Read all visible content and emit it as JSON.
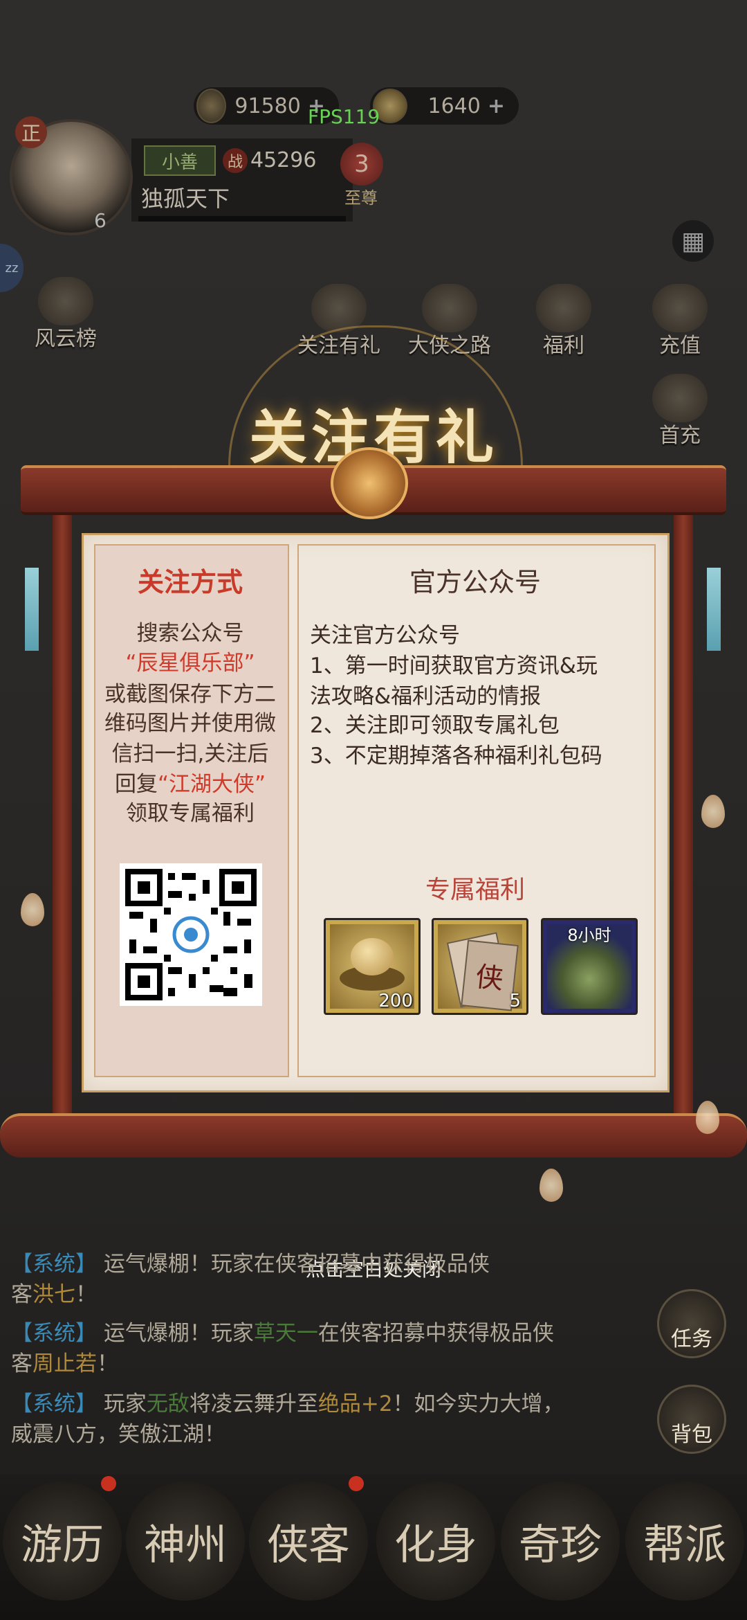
{
  "hud": {
    "coins": "91580",
    "ingots": "1640",
    "plus": "+",
    "fps": "FPS119",
    "rank_badge": "正",
    "level": "6",
    "title_tag": "小善",
    "power_icon": "战",
    "power": "45296",
    "player_name": "独孤天下",
    "vip_level": "3",
    "vip_label": "至尊",
    "grid_icon": "grid-icon",
    "zz_label": "zz"
  },
  "menu": [
    {
      "label": "风云榜"
    },
    {
      "label": "关注有礼"
    },
    {
      "label": "大侠之路"
    },
    {
      "label": "福利"
    },
    {
      "label": "充值"
    },
    {
      "label": "首充"
    }
  ],
  "dialog": {
    "banner": "关注有礼",
    "left": {
      "title": "关注方式",
      "line1": "搜索公众号",
      "line2": "“辰星俱乐部”",
      "line3": "或截图保存下方二",
      "line4": "维码图片并使用微",
      "line5": "信扫一扫,关注后",
      "line6_prefix": "回复",
      "line6_highlight": "“江湖大侠”",
      "line7": "领取专属福利"
    },
    "right": {
      "title": "官方公众号",
      "line1": "关注官方公众号",
      "line2": "1、第一时间获取官方资讯&玩",
      "line3": "法攻略&福利活动的情报",
      "line4": "2、关注即可领取专属礼包",
      "line5": "3、不定期掉落各种福利礼包码",
      "rewards_title": "专属福利",
      "rewards": [
        {
          "name": "ingot",
          "qty": "200"
        },
        {
          "name": "hero-card",
          "qty": "5"
        },
        {
          "name": "coin-chest",
          "tag": "8小时"
        }
      ]
    },
    "close_hint": "点击空白处关闭"
  },
  "chat": [
    {
      "tag": "【系统】",
      "t1": "运气爆棚！玩家",
      "name": "",
      "t2": "在侠客招募中获得极品侠",
      "t3": "客",
      "hero": "洪七",
      "t4": "！"
    },
    {
      "tag": "【系统】",
      "t1": "运气爆棚！玩家",
      "name": "草天一",
      "t2": "在侠客招募中获得极品侠",
      "t3": "客",
      "hero": "周止若",
      "t4": "！"
    },
    {
      "tag": "【系统】",
      "t1": "玩家",
      "name": "无敌",
      "t2": "将凌云舞升至",
      "grade": "绝品+2",
      "t3": "！如今实力大增，",
      "t4": "威震八方，笑傲江湖！"
    }
  ],
  "side": {
    "task": "任务",
    "bag": "背包"
  },
  "nav": [
    {
      "label": "游历"
    },
    {
      "label": "神州"
    },
    {
      "label": "侠客"
    },
    {
      "label": "化身"
    },
    {
      "label": "奇珍"
    },
    {
      "label": "帮派"
    }
  ],
  "colors": {
    "accent_red": "#c83a2a",
    "fps_green": "#7fff6a",
    "system_blue": "#3a8ab8"
  }
}
